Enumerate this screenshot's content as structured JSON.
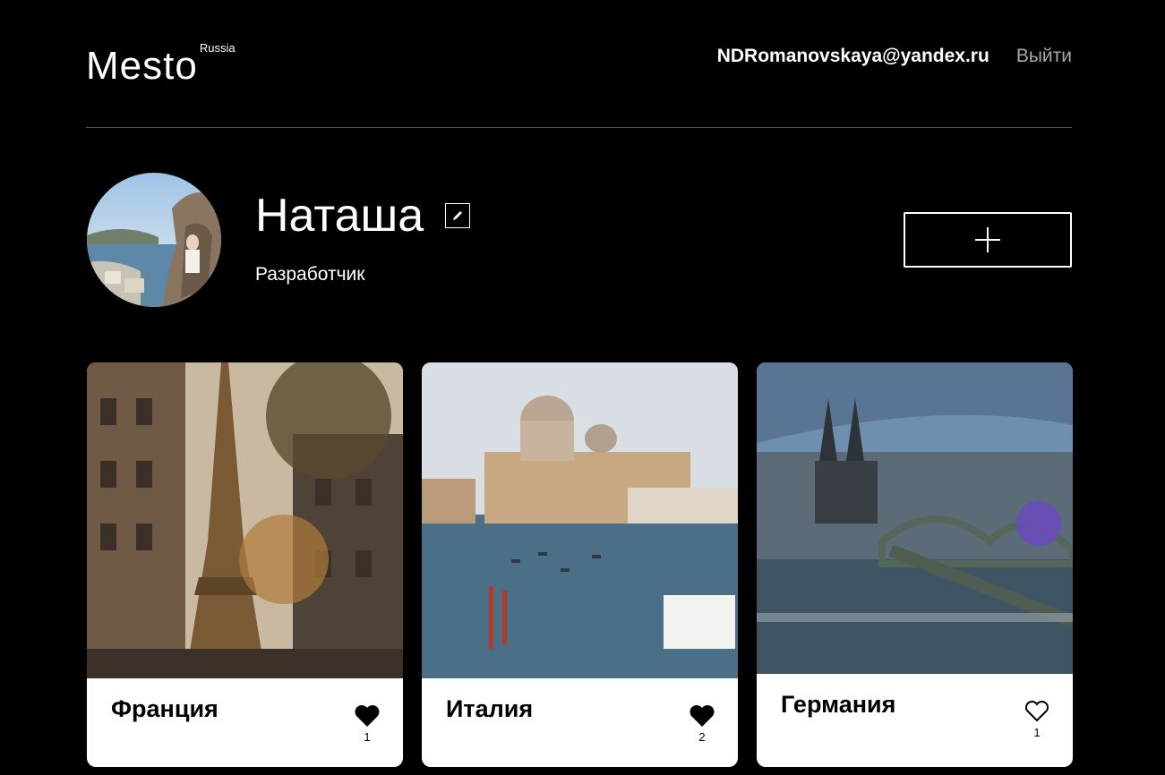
{
  "header": {
    "logo": "Mesto",
    "logo_sup": "Russia",
    "email": "NDRomanovskaya@yandex.ru",
    "logout": "Выйти"
  },
  "profile": {
    "name": "Наташа",
    "job": "Разработчик"
  },
  "cards": [
    {
      "title": "Франция",
      "likes": "1",
      "liked": true,
      "like_icon": "heart-filled"
    },
    {
      "title": "Италия",
      "likes": "2",
      "liked": true,
      "like_icon": "heart-filled"
    },
    {
      "title": "Германия",
      "likes": "1",
      "liked": false,
      "like_icon": "heart-outline"
    }
  ],
  "colors": {
    "background": "#000000",
    "card": "#ffffff",
    "divider": "#545454",
    "logout": "#a9a9a9"
  }
}
